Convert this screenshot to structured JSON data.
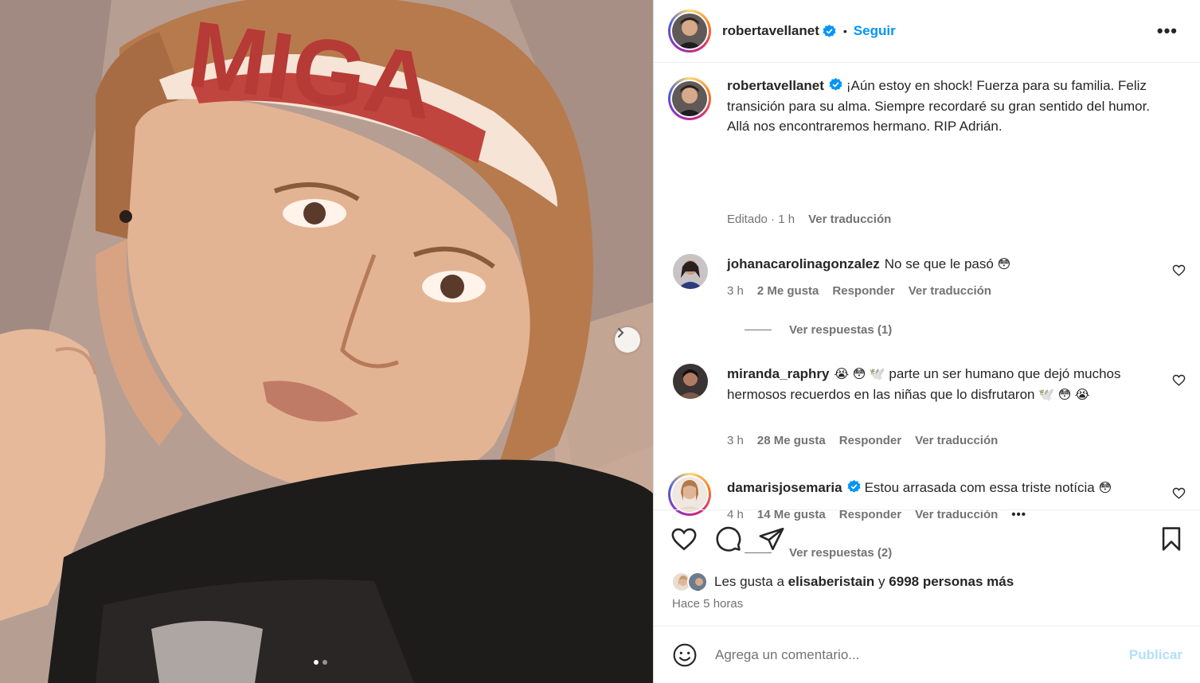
{
  "post": {
    "author": "robertavellanet",
    "follow_label": "Seguir",
    "separator": "•",
    "more_label": "•••"
  },
  "caption": {
    "author": "robertavellanet",
    "text": "¡Aún estoy en shock! Fuerza para su familia. Feliz transición para su alma. Siempre recordaré su gran sentido del humor. Allá nos encontraremos hermano. RIP Adrián.",
    "edited": "Editado · 1 h",
    "translate": "Ver traducción"
  },
  "comments": [
    {
      "username": "johanacarolinagonzalez",
      "text": "No se que le pasó",
      "emoji_after": "😳",
      "time": "3 h",
      "likes": "2 Me gusta",
      "reply": "Responder",
      "translate": "Ver traducción",
      "replies_label": "Ver respuestas (1)"
    },
    {
      "username": "miranda_raphry",
      "emoji_before": "😭 😳 🕊️",
      "text": "parte un ser humano que dejó muchos hermosos recuerdos en las niñas que lo disfrutaron",
      "emoji_after": "🕊️ 😳 😭",
      "time": "3 h",
      "likes": "28 Me gusta",
      "reply": "Responder",
      "translate": "Ver traducción"
    },
    {
      "username": "damarisjosemaria",
      "text": "Estou arrasada com essa triste notícia",
      "emoji_after": "😳",
      "time": "4 h",
      "likes": "14 Me gusta",
      "reply": "Responder",
      "translate": "Ver traducción",
      "more": "•••",
      "replies_label": "Ver respuestas (2)"
    }
  ],
  "likes": {
    "prefix": "Les gusta a",
    "user": "elisaberistain",
    "conj": "y",
    "others": "6998 personas más"
  },
  "time_ago": "Hace 5 horas",
  "comment_input": {
    "placeholder": "Agrega un comentario...",
    "publish": "Publicar"
  },
  "media": {
    "headband_text": "MIGA",
    "slides": 2,
    "current_slide": 1
  },
  "icons": {
    "verified": "verified-badge-icon",
    "like": "heart-icon",
    "comment": "comment-icon",
    "share": "share-icon",
    "save": "bookmark-icon",
    "emoji": "smile-icon",
    "next": "chevron-right-icon"
  },
  "colors": {
    "link": "#0095f6",
    "publish_disabled": "#b2dffc",
    "muted": "#737373"
  }
}
